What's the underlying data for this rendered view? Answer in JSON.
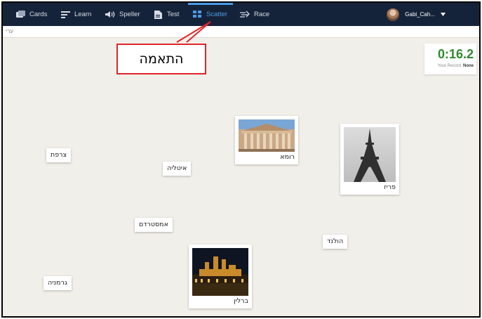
{
  "nav": {
    "items": [
      {
        "label": "Cards",
        "icon": "cards-icon"
      },
      {
        "label": "Learn",
        "icon": "learn-icon"
      },
      {
        "label": "Speller",
        "icon": "speaker-icon"
      },
      {
        "label": "Test",
        "icon": "test-icon"
      },
      {
        "label": "Scatter",
        "icon": "scatter-icon",
        "active": true
      },
      {
        "label": "Race",
        "icon": "race-icon"
      }
    ],
    "user_name": "Gabi_Cah...",
    "accent_color": "#4d9be8",
    "background_color": "#15233a"
  },
  "subbar": {
    "crumb": "ערי"
  },
  "callout": {
    "text": "התאמה",
    "border_color": "#e0262b"
  },
  "timer": {
    "time": "0:16.2",
    "record_label": "Your Record",
    "record_value": "None",
    "time_color": "#2e8b2e"
  },
  "tiles": {
    "france": "צרפת",
    "italy": "איטליה",
    "amsterdam": "אמסטרדם",
    "holland": "הולנד",
    "germany": "גרמניה",
    "rome": "רומא",
    "paris": "פריז",
    "berlin": "ברלין"
  }
}
